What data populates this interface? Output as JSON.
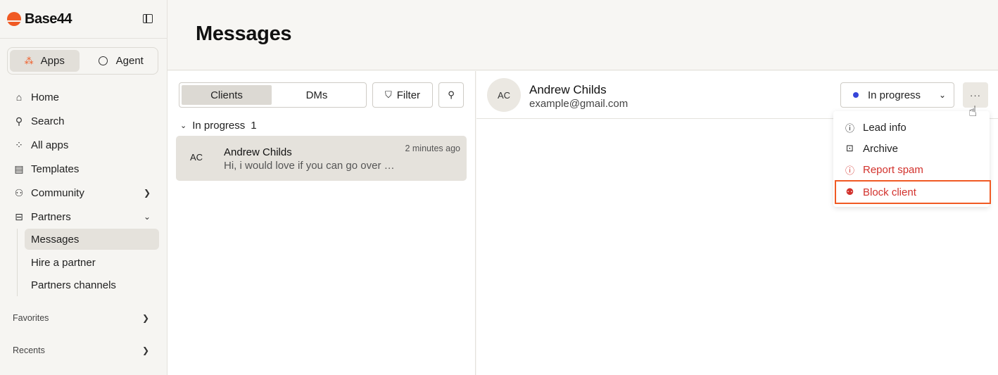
{
  "brand": {
    "name": "Base44",
    "accent": "#f05a24"
  },
  "mode_toggle": {
    "apps_label": "Apps",
    "agent_label": "Agent"
  },
  "nav": {
    "home": "Home",
    "search": "Search",
    "all_apps": "All apps",
    "templates": "Templates",
    "community": "Community",
    "partners": "Partners",
    "partners_sub": [
      "Messages",
      "Hire a partner",
      "Partners channels"
    ],
    "favorites": "Favorites",
    "recents": "Recents"
  },
  "page": {
    "title": "Messages"
  },
  "list": {
    "tabs": [
      "Clients",
      "DMs"
    ],
    "filter_label": "Filter",
    "group": {
      "label": "In progress",
      "count": "1"
    },
    "conversation": {
      "initials": "AC",
      "name": "Andrew Childs",
      "preview": "Hi, i would love if you can go over my app",
      "time": "2 minutes ago"
    }
  },
  "detail": {
    "initials": "AC",
    "name": "Andrew Childs",
    "email": "example@gmail.com",
    "status": {
      "label": "In progress",
      "color": "#3645d9"
    },
    "more_label": "···",
    "menu": [
      "Lead info",
      "Archive",
      "Report spam",
      "Block client"
    ],
    "danger_color": "#d2322d"
  }
}
